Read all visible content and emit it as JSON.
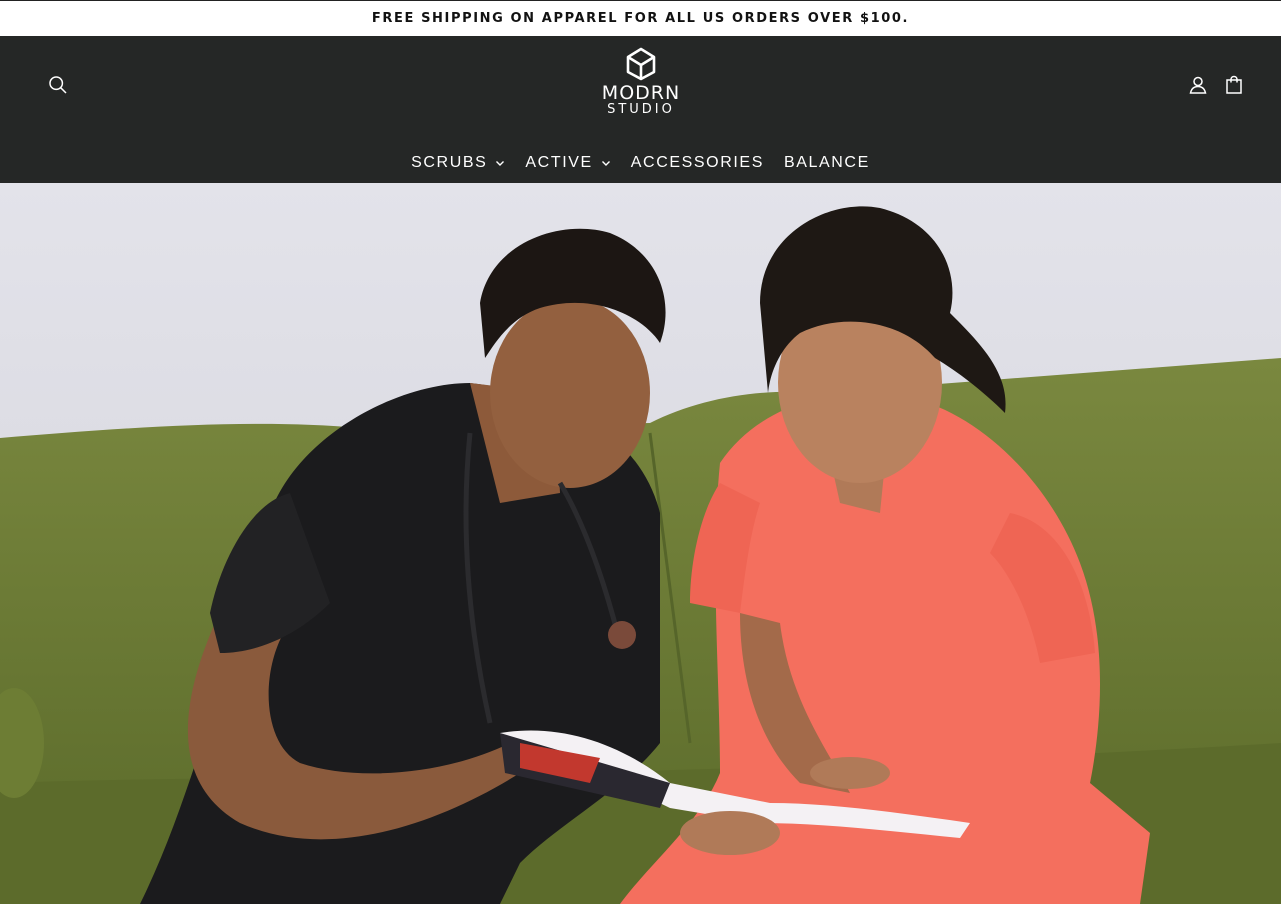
{
  "announcement": {
    "text": "FREE SHIPPING ON APPAREL FOR ALL US ORDERS OVER $100."
  },
  "header": {
    "logo": {
      "line1": "MODRN",
      "line2": "STUDIO",
      "icon": "hexagon-m-logo-icon"
    },
    "icons": {
      "search": "search-icon",
      "account": "user-icon",
      "cart": "bag-icon"
    }
  },
  "nav": {
    "items": [
      {
        "label": "SCRUBS",
        "has_dropdown": true
      },
      {
        "label": "ACTIVE",
        "has_dropdown": true
      },
      {
        "label": "ACCESSORIES",
        "has_dropdown": false
      },
      {
        "label": "BALANCE",
        "has_dropdown": false
      }
    ]
  },
  "hero": {
    "image": "two-nurses-reading-magazine-on-green-sofa"
  },
  "colors": {
    "header_bg": "#252726",
    "announcement_bg": "#ffffff",
    "text_light": "#ffffff",
    "text_dark": "#121212",
    "sofa_green": "#6b7a3a",
    "scrub_black": "#1b1b1d",
    "scrub_coral": "#f46f5e",
    "wall": "#dcdce4"
  }
}
